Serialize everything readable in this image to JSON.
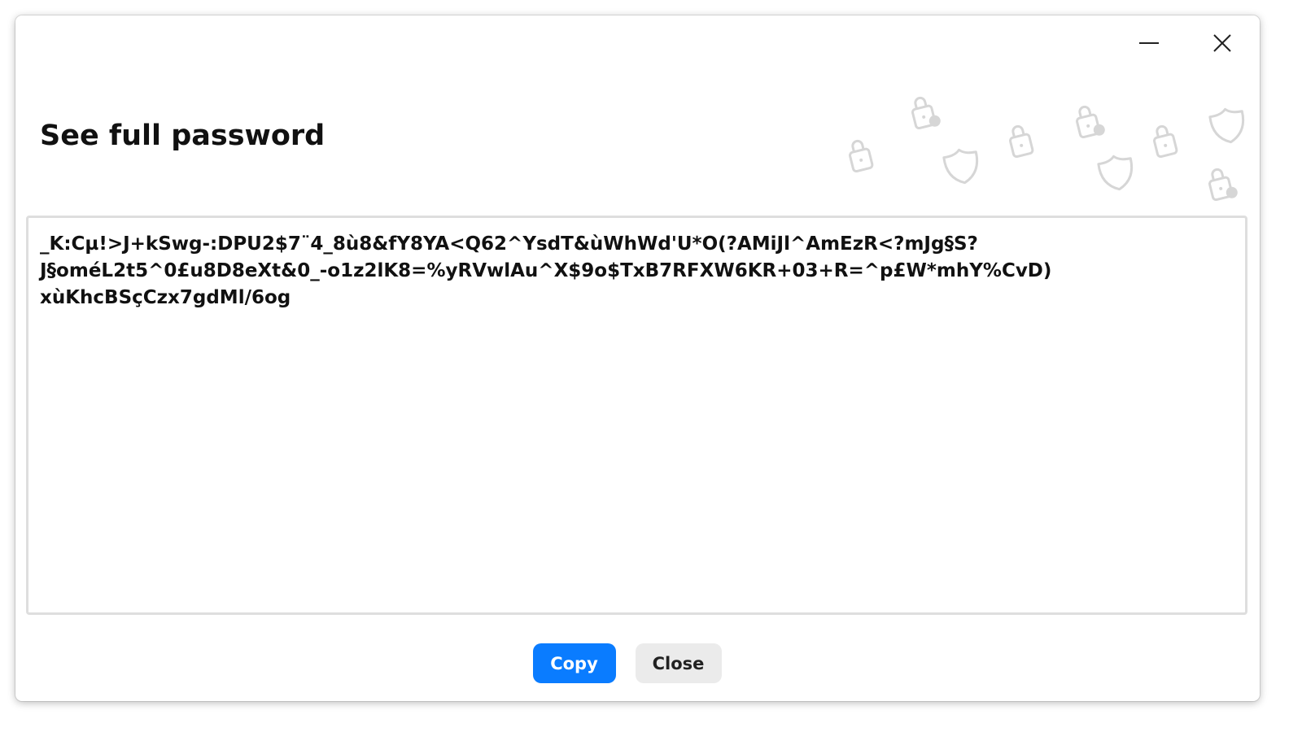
{
  "dialog": {
    "title": "See full password",
    "password": "_K:Cµ!>J+kSwg-:DPU2$7¨4_8ù8&fY8YA<Q62^YsdT&ùWhWd'U*O(?AMiJl^AmEzR<?mJg§S?\nJ§oméL2t5^0£u8D8eXt&0_-o1z2lK8=%yRVwlAu^X$9o$TxB7RFXW6KR+03+R=^p£W*mhY%CvD)\nxùKhcBSçCzx7gdMl/6og",
    "buttons": {
      "copy_label": "Copy",
      "close_label": "Close"
    }
  },
  "window_controls": {
    "minimize_icon": "minimize-icon",
    "close_icon": "close-icon"
  },
  "colors": {
    "accent": "#0a7cff",
    "secondary_button": "#ebebeb",
    "decoration": "#d6d6d6"
  }
}
